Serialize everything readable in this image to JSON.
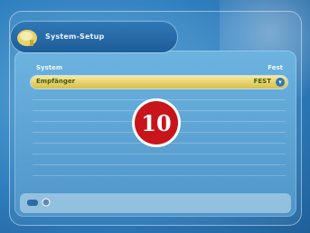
{
  "header": {
    "title": "System-Setup"
  },
  "columns": {
    "left": "System",
    "right": "Fest"
  },
  "selected_row": {
    "label": "Empfänger",
    "value": "FEST"
  },
  "badge": {
    "number": "10"
  },
  "colors": {
    "background": "#2f7fbf",
    "selection": "#d9bd45",
    "badge": "#c8151b"
  },
  "icons": {
    "title": "dish-folder-icon",
    "footer": [
      "remote-icon",
      "circle-button-icon"
    ]
  }
}
